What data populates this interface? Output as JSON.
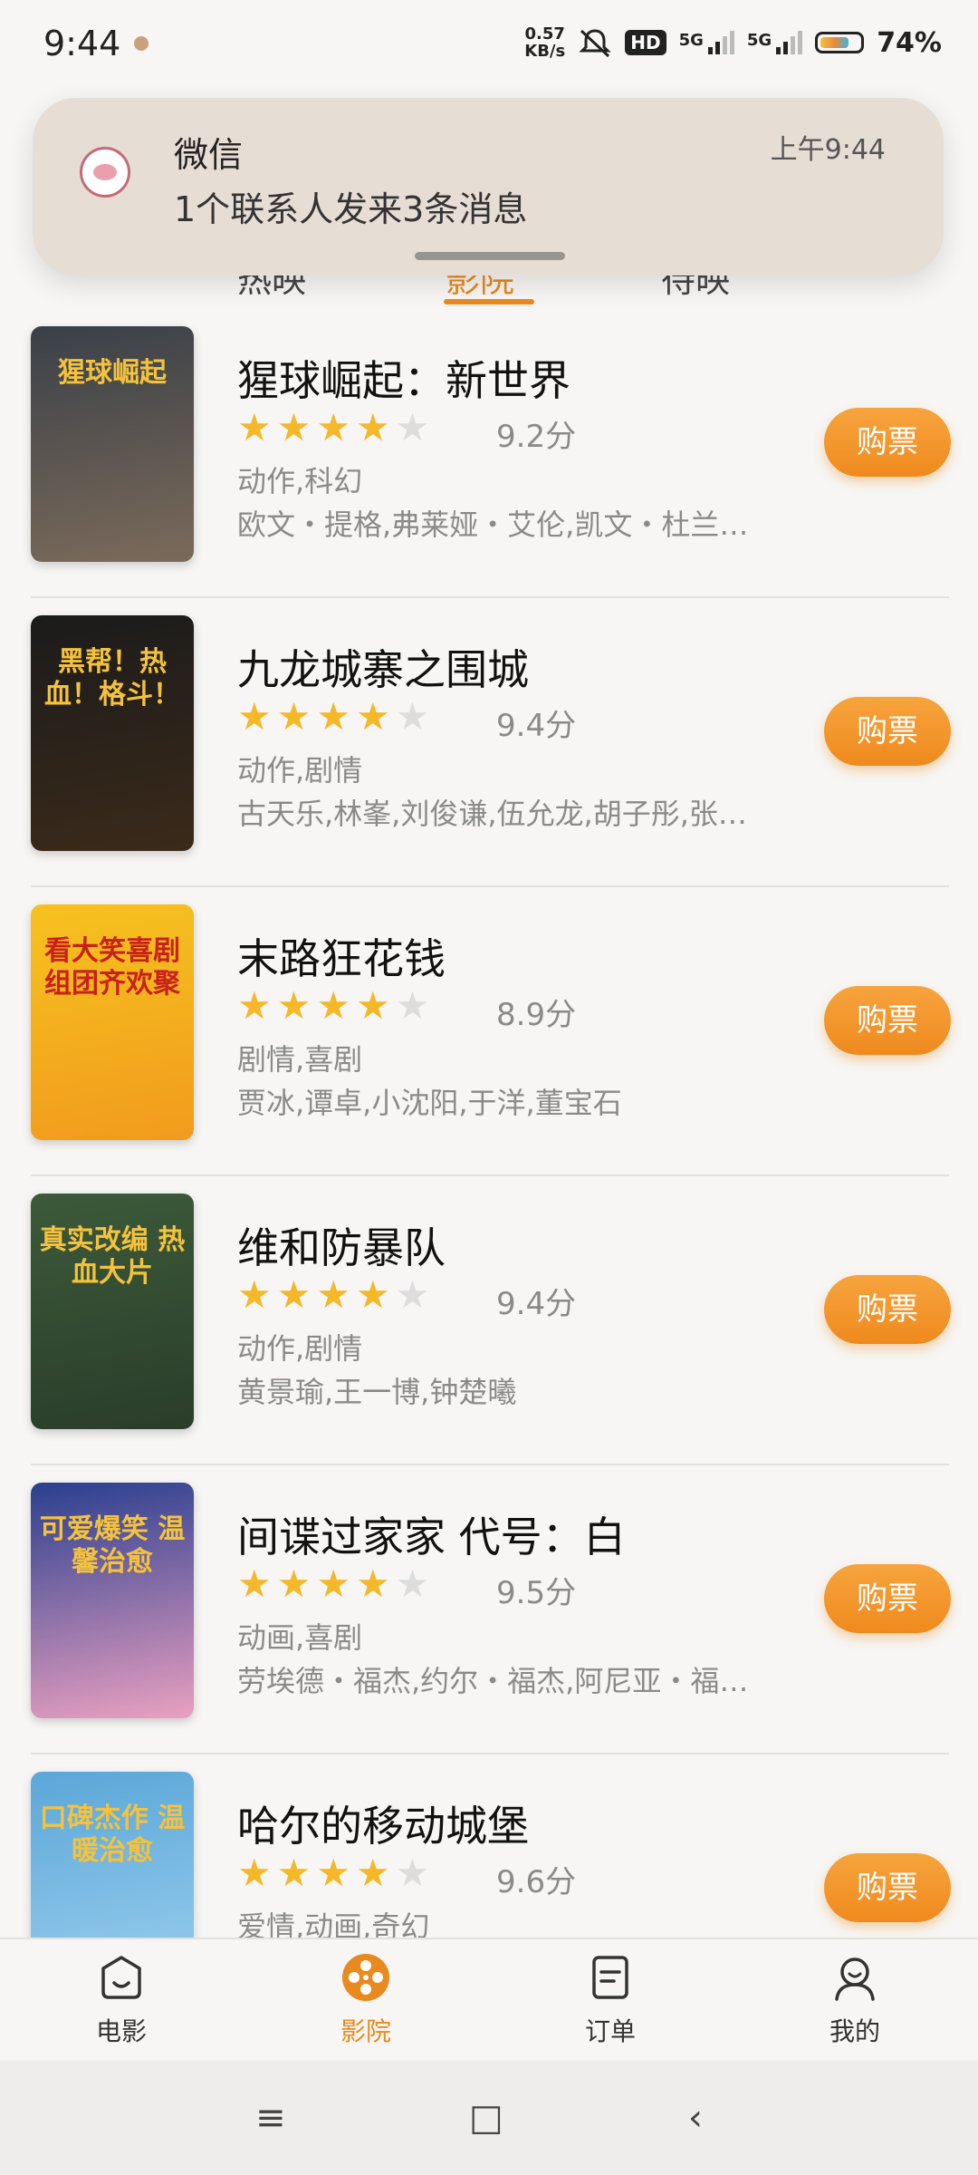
{
  "status_bar": {
    "time": "9:44",
    "net_speed_value": "0.57",
    "net_speed_unit": "KB/s",
    "hd": "HD",
    "sig1": "5G",
    "sig2": "5G",
    "battery": "74%",
    "battery_level": 0.74
  },
  "notification": {
    "app": "微信",
    "time": "上午9:44",
    "message": "1个联系人发来3条消息"
  },
  "tabs": [
    {
      "label": "热映",
      "active": false
    },
    {
      "label": "影院",
      "active": true
    },
    {
      "label": "待映",
      "active": false
    }
  ],
  "movies": [
    {
      "title": "猩球崛起：新世界",
      "rating_stars": 4,
      "score": "9.2分",
      "genre": "动作,科幻",
      "cast": "欧文・提格,弗莱娅・艾伦,凯文・杜兰…",
      "buy_label": "购票",
      "poster_text": "猩球崛起",
      "poster_colors": [
        "#3a4048",
        "#7b6a5a"
      ]
    },
    {
      "title": "九龙城寨之围城",
      "rating_stars": 4,
      "score": "9.4分",
      "genre": "动作,剧情",
      "cast": "古天乐,林峯,刘俊谦,伍允龙,胡子彤,张…",
      "buy_label": "购票",
      "poster_text": "黑帮！热血！格斗！",
      "poster_colors": [
        "#1b1b1b",
        "#3b2a1a"
      ]
    },
    {
      "title": "末路狂花钱",
      "rating_stars": 4,
      "score": "8.9分",
      "genre": "剧情,喜剧",
      "cast": "贾冰,谭卓,小沈阳,于洋,董宝石",
      "buy_label": "购票",
      "poster_text": "看大笑喜剧 组团齐欢聚",
      "poster_colors": [
        "#f6c21f",
        "#f19b1d"
      ]
    },
    {
      "title": "维和防暴队",
      "rating_stars": 4,
      "score": "9.4分",
      "genre": "动作,剧情",
      "cast": "黄景瑜,王一博,钟楚曦",
      "buy_label": "购票",
      "poster_text": "真实改编 热血大片",
      "poster_colors": [
        "#3c5a3a",
        "#2a3d2a"
      ]
    },
    {
      "title": "间谍过家家 代号：白",
      "rating_stars": 4,
      "score": "9.5分",
      "genre": "动画,喜剧",
      "cast": "劳埃德・福杰,约尔・福杰,阿尼亚・福…",
      "buy_label": "购票",
      "poster_text": "可爱爆笑 温馨治愈",
      "poster_colors": [
        "#2a3f8f",
        "#e9a0c0"
      ]
    },
    {
      "title": "哈尔的移动城堡",
      "rating_stars": 4,
      "score": "9.6分",
      "genre": "爱情,动画,奇幻",
      "cast": "",
      "buy_label": "购票",
      "poster_text": "口碑杰作 温暖治愈",
      "poster_colors": [
        "#5aa7d8",
        "#9fd0ef"
      ]
    }
  ],
  "bottom_nav": [
    {
      "label": "电影",
      "icon": "movie-icon",
      "active": false
    },
    {
      "label": "影院",
      "icon": "cinema-reel-icon",
      "active": true
    },
    {
      "label": "订单",
      "icon": "order-icon",
      "active": false
    },
    {
      "label": "我的",
      "icon": "profile-icon",
      "active": false
    }
  ],
  "system_nav": {
    "menu": "≡",
    "home": "□",
    "back": "‹"
  },
  "colors": {
    "accent": "#e88a1e",
    "star": "#f4b829",
    "background": "#f7f6f4"
  }
}
